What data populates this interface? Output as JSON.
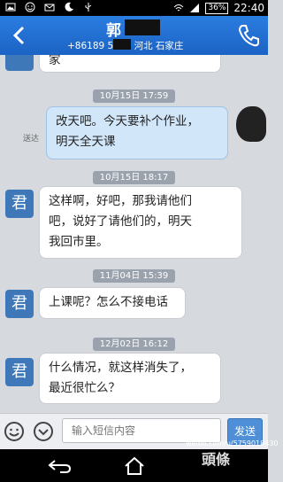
{
  "statusbar": {
    "battery": "36%",
    "time": "22:40"
  },
  "header": {
    "name": "郭",
    "info": "+86189     5423  河北 石家庄"
  },
  "chat": {
    "top_partial": "家",
    "messages": [
      {
        "time": "10月15日 17:59"
      },
      {
        "text": "改天吧。今天要补个作业，\n明天全天课",
        "status": "送达"
      },
      {
        "time": "10月15日 18:17"
      },
      {
        "avatar": "君",
        "text": "这样啊，好吧，那我请他们\n吧，说好了请他们的，明天\n我回市里。"
      },
      {
        "time": "11月04日 15:39"
      },
      {
        "avatar": "君",
        "text": "上课呢？怎么不接电话"
      },
      {
        "time": "12月02日 16:12"
      },
      {
        "avatar": "君",
        "text": "什么情况，就这样消失了，\n最近很忙么？"
      }
    ]
  },
  "input": {
    "placeholder": "输入短信内容",
    "send": "发送"
  },
  "watermark": {
    "url": "weibo.com/u/5759018430",
    "logo": "頭條"
  }
}
